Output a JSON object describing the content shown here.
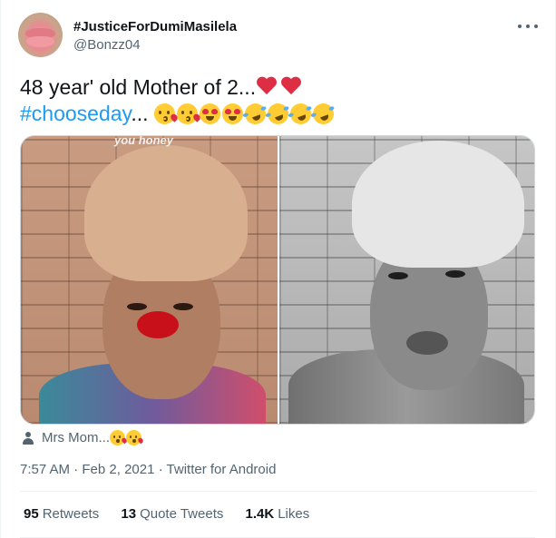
{
  "author": {
    "display_name": "#JusticeForDumiMasilela",
    "handle": "@Bonzz04"
  },
  "tweet": {
    "line1_text": "48 year' old Mother of 2...",
    "line1_emojis": [
      "red-heart",
      "red-heart"
    ],
    "hashtag": "#chooseday",
    "line2_suffix": "...",
    "line2_emojis": [
      "face-blowing-a-kiss",
      "face-blowing-a-kiss",
      "smiling-face-with-heart-eyes",
      "smiling-face-with-heart-eyes",
      "rolling-on-the-floor-laughing",
      "rolling-on-the-floor-laughing",
      "rolling-on-the-floor-laughing",
      "rolling-on-the-floor-laughing"
    ]
  },
  "media": {
    "left_overlay_text": "you honey"
  },
  "tagged": {
    "label": "Mrs Mom...",
    "emojis": [
      "face-blowing-a-kiss",
      "face-blowing-a-kiss"
    ]
  },
  "meta": {
    "time": "7:57 AM",
    "separator": "·",
    "date": "Feb 2, 2021",
    "source": "Twitter for Android"
  },
  "stats": {
    "retweets_count": "95",
    "retweets_label": "Retweets",
    "quotes_count": "13",
    "quotes_label": "Quote Tweets",
    "likes_count": "1.4K",
    "likes_label": "Likes"
  },
  "colors": {
    "text_primary": "#0f1419",
    "text_secondary": "#536471",
    "link": "#1d9bf0",
    "divider": "#eff3f4"
  }
}
